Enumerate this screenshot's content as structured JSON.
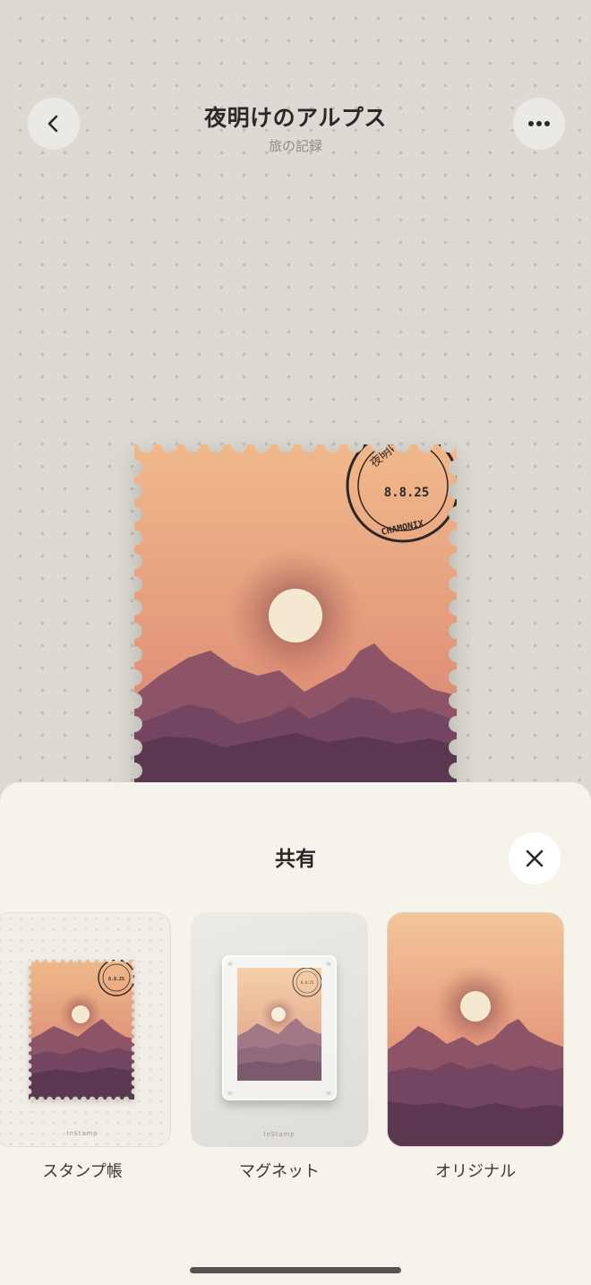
{
  "header": {
    "title": "夜明けのアルプス",
    "subtitle": "旅の記録",
    "back_icon": "chevron-left-icon",
    "more_icon": "ellipsis-icon"
  },
  "stamp": {
    "postmark_date": "8.8.25",
    "postmark_top": "夜明け",
    "postmark_bottom": "CHAMONIX",
    "colors": {
      "sky_top": "#f0b98a",
      "sky_bottom": "#d9826f",
      "sun": "#f4e9d0",
      "mountain_far": "#8c5466",
      "mountain_mid": "#744560",
      "mountain_near": "#5c3850"
    }
  },
  "share_sheet": {
    "title": "共有",
    "close_icon": "close-icon",
    "options": [
      {
        "label": "スタンプ帳",
        "brand": "InStamp"
      },
      {
        "label": "マグネット",
        "brand": "InStamp"
      },
      {
        "label": "オリジナル"
      }
    ]
  }
}
